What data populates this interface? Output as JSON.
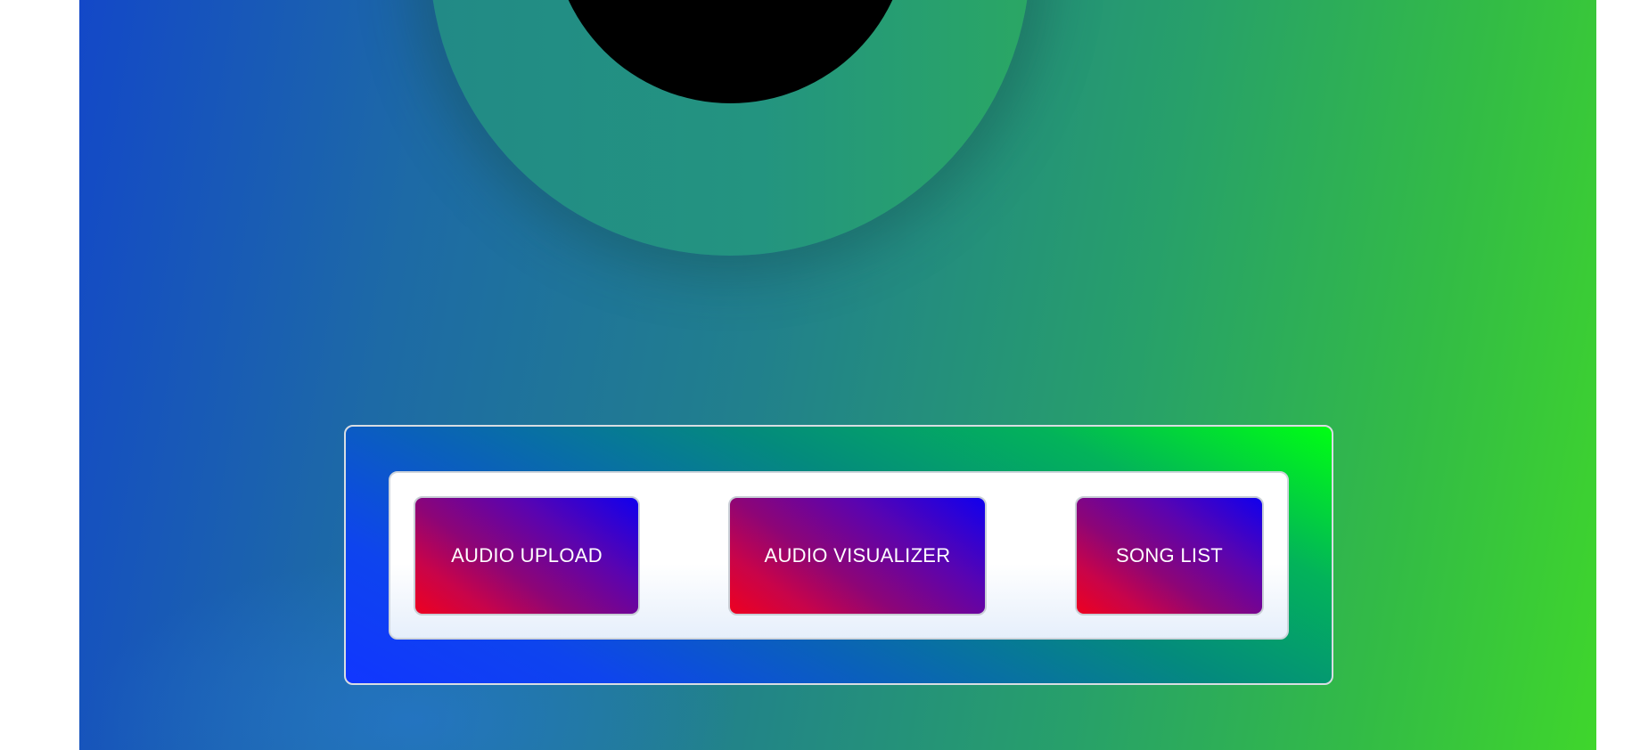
{
  "nav": {
    "buttons": [
      {
        "label": "AUDIO UPLOAD"
      },
      {
        "label": "AUDIO VISUALIZER"
      },
      {
        "label": "SONG LIST"
      }
    ]
  },
  "colors": {
    "background_left": "#1348c8",
    "background_right": "#3fd62c",
    "button_gradient_top_right": "#1000ee",
    "button_gradient_bottom_left": "#ee0020",
    "frame_gradient_top_right": "#00ff13",
    "frame_gradient_bottom_left": "#1136ff",
    "disc_hole": "#000000"
  }
}
